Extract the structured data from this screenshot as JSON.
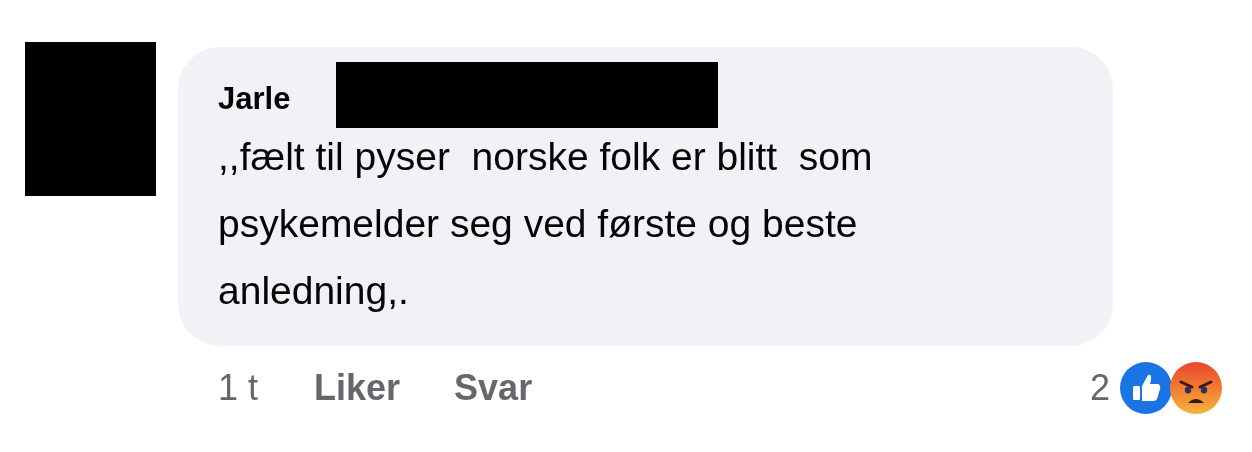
{
  "comment": {
    "author": "Jarle",
    "text": ",,fælt til pyser  norske folk er blitt  som psykemelder seg ved første og beste anledning,.",
    "time": "1 t",
    "actions": [
      "Liker",
      "Svar"
    ],
    "reaction_count": "2",
    "reactions": [
      {
        "kind": "like"
      },
      {
        "kind": "angry"
      }
    ]
  }
}
